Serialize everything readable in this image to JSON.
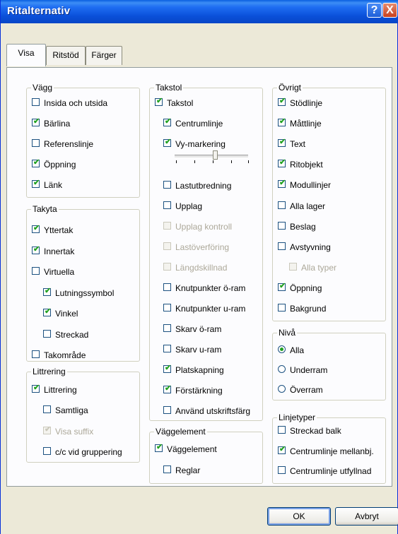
{
  "window": {
    "title": "Ritalternativ",
    "help_icon": "?",
    "close_icon": "X"
  },
  "tabs": [
    "Visa",
    "Ritstöd",
    "Färger"
  ],
  "active_tab": "Visa",
  "groups": {
    "vagg": {
      "legend": "Vägg",
      "items": [
        {
          "label": "Insida och utsida",
          "checked": false
        },
        {
          "label": "Bärlina",
          "checked": true
        },
        {
          "label": "Referenslinje",
          "checked": false
        },
        {
          "label": "Öppning",
          "checked": true
        },
        {
          "label": "Länk",
          "checked": true
        }
      ]
    },
    "takyta": {
      "legend": "Takyta",
      "items": [
        {
          "label": "Yttertak",
          "checked": true
        },
        {
          "label": "Innertak",
          "checked": true
        },
        {
          "label": "Virtuella",
          "checked": false
        },
        {
          "label": "Lutningssymbol",
          "checked": true
        },
        {
          "label": "Vinkel",
          "checked": true
        },
        {
          "label": "Streckad",
          "checked": false
        },
        {
          "label": "Takområde",
          "checked": false
        }
      ]
    },
    "littrering": {
      "legend": "Littrering",
      "items": [
        {
          "label": "Littrering",
          "checked": true
        },
        {
          "label": "Samtliga",
          "checked": false
        },
        {
          "label": "Visa suffix",
          "checked": true,
          "disabled": true
        },
        {
          "label": "c/c vid gruppering",
          "checked": false
        }
      ]
    },
    "takstol": {
      "legend": "Takstol",
      "items": [
        {
          "label": "Takstol",
          "checked": true
        },
        {
          "label": "Centrumlinje",
          "checked": true
        },
        {
          "label": "Vy-markering",
          "checked": true
        },
        {
          "label": "Lastutbredning",
          "checked": false
        },
        {
          "label": "Upplag",
          "checked": false
        },
        {
          "label": "Upplag kontroll",
          "checked": false,
          "disabled": true
        },
        {
          "label": "Lastöverföring",
          "checked": false,
          "disabled": true
        },
        {
          "label": "Längdskillnad",
          "checked": false,
          "disabled": true
        },
        {
          "label": "Knutpunkter ö-ram",
          "checked": false
        },
        {
          "label": "Knutpunkter u-ram",
          "checked": false
        },
        {
          "label": "Skarv ö-ram",
          "checked": false
        },
        {
          "label": "Skarv u-ram",
          "checked": false
        },
        {
          "label": "Platskapning",
          "checked": true
        },
        {
          "label": "Förstärkning",
          "checked": true
        },
        {
          "label": "Använd utskriftsfärg",
          "checked": false
        }
      ],
      "slider_value_fraction": 0.55
    },
    "vaggelement": {
      "legend": "Väggelement",
      "items": [
        {
          "label": "Väggelement",
          "checked": true
        },
        {
          "label": "Reglar",
          "checked": false
        }
      ]
    },
    "ovrigt": {
      "legend": "Övrigt",
      "items": [
        {
          "label": "Stödlinje",
          "checked": true
        },
        {
          "label": "Måttlinje",
          "checked": true
        },
        {
          "label": "Text",
          "checked": true
        },
        {
          "label": "Ritobjekt",
          "checked": true
        },
        {
          "label": "Modullinjer",
          "checked": true
        },
        {
          "label": "Alla lager",
          "checked": false
        },
        {
          "label": "Beslag",
          "checked": false
        },
        {
          "label": "Avstyvning",
          "checked": false
        },
        {
          "label": "Alla typer",
          "checked": false,
          "disabled": true
        },
        {
          "label": "Öppning",
          "checked": true
        },
        {
          "label": "Bakgrund",
          "checked": false
        }
      ]
    },
    "niva": {
      "legend": "Nivå",
      "options": [
        "Alla",
        "Underram",
        "Överram"
      ],
      "selected": "Alla"
    },
    "linjetyper": {
      "legend": "Linjetyper",
      "items": [
        {
          "label": "Streckad balk",
          "checked": false
        },
        {
          "label": "Centrumlinje mellanbj.",
          "checked": true
        },
        {
          "label": "Centrumlinje utfyllnad",
          "checked": false
        }
      ]
    }
  },
  "buttons": {
    "ok": "OK",
    "cancel": "Avbryt"
  },
  "colors": {
    "titlebar": "#0a4fd9",
    "check": "#21a121",
    "dialog_bg": "#ece9d8"
  }
}
